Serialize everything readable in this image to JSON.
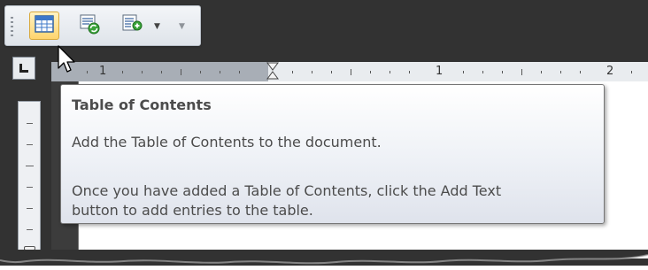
{
  "toolbar": {
    "buttons": [
      {
        "name": "table-of-contents",
        "icon": "table-of-contents-icon",
        "active": true
      },
      {
        "name": "update-table",
        "icon": "update-table-icon",
        "active": false
      },
      {
        "name": "add-text",
        "icon": "add-text-icon",
        "active": false
      }
    ]
  },
  "ruler": {
    "numbers": [
      "1",
      "1",
      "2"
    ]
  },
  "tooltip": {
    "title": "Table of Contents",
    "line1": "Add the Table of Contents to the document.",
    "line2": "Once you have added a Table of Contents, click the Add Text",
    "line3": "button to add entries to the table."
  },
  "colors": {
    "background": "#323232",
    "active_button": "#ffd56e",
    "tooltip_text": "#4c4c4c"
  }
}
